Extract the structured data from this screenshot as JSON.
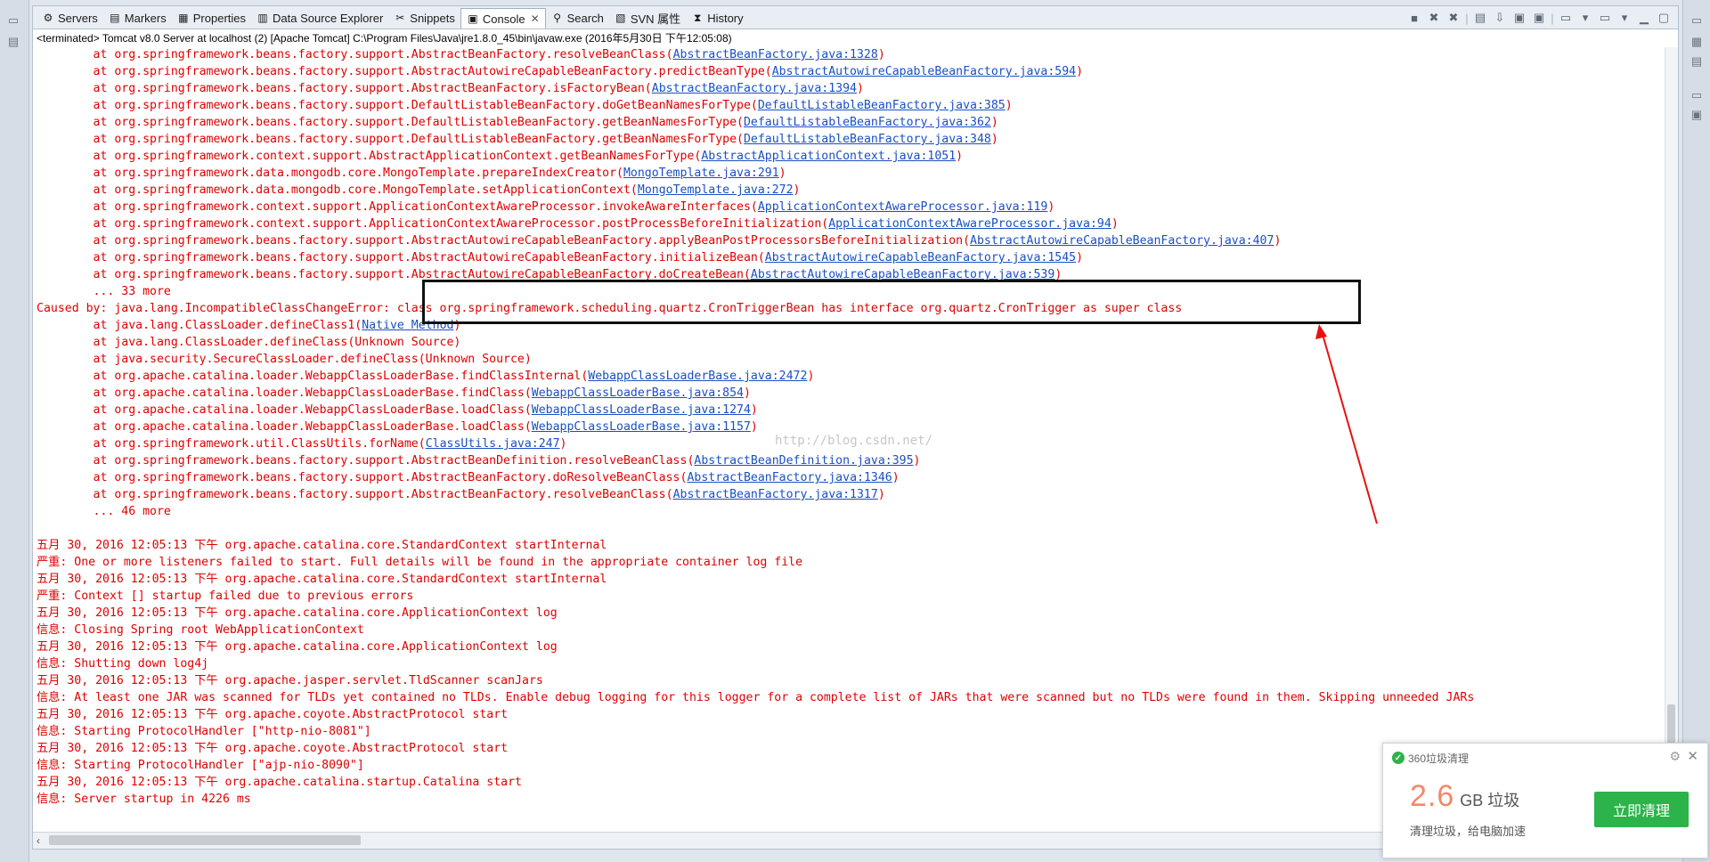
{
  "tabs": [
    {
      "label": "Servers",
      "icon": "servers-icon",
      "glyph": "⚙"
    },
    {
      "label": "Markers",
      "icon": "markers-icon",
      "glyph": "▤"
    },
    {
      "label": "Properties",
      "icon": "properties-icon",
      "glyph": "▦"
    },
    {
      "label": "Data Source Explorer",
      "icon": "data-source-icon",
      "glyph": "▥"
    },
    {
      "label": "Snippets",
      "icon": "snippets-icon",
      "glyph": "✂"
    },
    {
      "label": "Console",
      "icon": "console-icon",
      "glyph": "▣",
      "active": true,
      "close": "✕"
    },
    {
      "label": "Search",
      "icon": "search-icon",
      "glyph": "⚲"
    },
    {
      "label": "SVN 属性",
      "icon": "svn-icon",
      "glyph": "▧"
    },
    {
      "label": "History",
      "icon": "history-icon",
      "glyph": "⧗"
    }
  ],
  "console": {
    "status": "<terminated> Tomcat v8.0 Server at localhost (2) [Apache Tomcat] C:\\Program Files\\Java\\jre1.8.0_45\\bin\\javaw.exe (2016年5月30日 下午12:05:08)"
  },
  "log_lines": [
    {
      "text": "        at org.springframework.beans.factory.support.AbstractBeanFactory.resolveBeanClass(",
      "link": "AbstractBeanFactory.java:1328",
      "end": ")"
    },
    {
      "text": "        at org.springframework.beans.factory.support.AbstractAutowireCapableBeanFactory.predictBeanType(",
      "link": "AbstractAutowireCapableBeanFactory.java:594",
      "end": ")"
    },
    {
      "text": "        at org.springframework.beans.factory.support.AbstractBeanFactory.isFactoryBean(",
      "link": "AbstractBeanFactory.java:1394",
      "end": ")"
    },
    {
      "text": "        at org.springframework.beans.factory.support.DefaultListableBeanFactory.doGetBeanNamesForType(",
      "link": "DefaultListableBeanFactory.java:385",
      "end": ")"
    },
    {
      "text": "        at org.springframework.beans.factory.support.DefaultListableBeanFactory.getBeanNamesForType(",
      "link": "DefaultListableBeanFactory.java:362",
      "end": ")"
    },
    {
      "text": "        at org.springframework.beans.factory.support.DefaultListableBeanFactory.getBeanNamesForType(",
      "link": "DefaultListableBeanFactory.java:348",
      "end": ")"
    },
    {
      "text": "        at org.springframework.context.support.AbstractApplicationContext.getBeanNamesForType(",
      "link": "AbstractApplicationContext.java:1051",
      "end": ")"
    },
    {
      "text": "        at org.springframework.data.mongodb.core.MongoTemplate.prepareIndexCreator(",
      "link": "MongoTemplate.java:291",
      "end": ")"
    },
    {
      "text": "        at org.springframework.data.mongodb.core.MongoTemplate.setApplicationContext(",
      "link": "MongoTemplate.java:272",
      "end": ")"
    },
    {
      "text": "        at org.springframework.context.support.ApplicationContextAwareProcessor.invokeAwareInterfaces(",
      "link": "ApplicationContextAwareProcessor.java:119",
      "end": ")"
    },
    {
      "text": "        at org.springframework.context.support.ApplicationContextAwareProcessor.postProcessBeforeInitialization(",
      "link": "ApplicationContextAwareProcessor.java:94",
      "end": ")"
    },
    {
      "text": "        at org.springframework.beans.factory.support.AbstractAutowireCapableBeanFactory.applyBeanPostProcessorsBeforeInitialization(",
      "link": "AbstractAutowireCapableBeanFactory.java:407",
      "end": ")"
    },
    {
      "text": "        at org.springframework.beans.factory.support.AbstractAutowireCapableBeanFactory.initializeBean(",
      "link": "AbstractAutowireCapableBeanFactory.java:1545",
      "end": ")"
    },
    {
      "text": "        at org.springframework.beans.factory.support.AbstractAutowireCapableBeanFactory.doCreateBean(",
      "link": "AbstractAutowireCapableBeanFactory.java:539",
      "end": ")"
    },
    {
      "text": "        ... 33 more"
    },
    {
      "text": "Caused by: java.lang.IncompatibleClassChangeError: class org.springframework.scheduling.quartz.CronTriggerBean has interface org.quartz.CronTrigger as super class"
    },
    {
      "text": "        at java.lang.ClassLoader.defineClass1(",
      "link": "Native Method",
      "end": ")"
    },
    {
      "text": "        at java.lang.ClassLoader.defineClass(Unknown Source)"
    },
    {
      "text": "        at java.security.SecureClassLoader.defineClass(Unknown Source)"
    },
    {
      "text": "        at org.apache.catalina.loader.WebappClassLoaderBase.findClassInternal(",
      "link": "WebappClassLoaderBase.java:2472",
      "end": ")"
    },
    {
      "text": "        at org.apache.catalina.loader.WebappClassLoaderBase.findClass(",
      "link": "WebappClassLoaderBase.java:854",
      "end": ")"
    },
    {
      "text": "        at org.apache.catalina.loader.WebappClassLoaderBase.loadClass(",
      "link": "WebappClassLoaderBase.java:1274",
      "end": ")"
    },
    {
      "text": "        at org.apache.catalina.loader.WebappClassLoaderBase.loadClass(",
      "link": "WebappClassLoaderBase.java:1157",
      "end": ")"
    },
    {
      "text": "        at org.springframework.util.ClassUtils.forName(",
      "link": "ClassUtils.java:247",
      "end": ")"
    },
    {
      "text": "        at org.springframework.beans.factory.support.AbstractBeanDefinition.resolveBeanClass(",
      "link": "AbstractBeanDefinition.java:395",
      "end": ")"
    },
    {
      "text": "        at org.springframework.beans.factory.support.AbstractBeanFactory.doResolveBeanClass(",
      "link": "AbstractBeanFactory.java:1346",
      "end": ")"
    },
    {
      "text": "        at org.springframework.beans.factory.support.AbstractBeanFactory.resolveBeanClass(",
      "link": "AbstractBeanFactory.java:1317",
      "end": ")"
    },
    {
      "text": "        ... 46 more"
    },
    {
      "text": ""
    },
    {
      "text": "五月 30, 2016 12:05:13 下午 org.apache.catalina.core.StandardContext startInternal"
    },
    {
      "text": "严重: One or more listeners failed to start. Full details will be found in the appropriate container log file"
    },
    {
      "text": "五月 30, 2016 12:05:13 下午 org.apache.catalina.core.StandardContext startInternal"
    },
    {
      "text": "严重: Context [] startup failed due to previous errors"
    },
    {
      "text": "五月 30, 2016 12:05:13 下午 org.apache.catalina.core.ApplicationContext log"
    },
    {
      "text": "信息: Closing Spring root WebApplicationContext"
    },
    {
      "text": "五月 30, 2016 12:05:13 下午 org.apache.catalina.core.ApplicationContext log"
    },
    {
      "text": "信息: Shutting down log4j"
    },
    {
      "text": "五月 30, 2016 12:05:13 下午 org.apache.jasper.servlet.TldScanner scanJars"
    },
    {
      "text": "信息: At least one JAR was scanned for TLDs yet contained no TLDs. Enable debug logging for this logger for a complete list of JARs that were scanned but no TLDs were found in them. Skipping unneeded JARs"
    },
    {
      "text": "五月 30, 2016 12:05:13 下午 org.apache.coyote.AbstractProtocol start"
    },
    {
      "text": "信息: Starting ProtocolHandler [\"http-nio-8081\"]"
    },
    {
      "text": "五月 30, 2016 12:05:13 下午 org.apache.coyote.AbstractProtocol start"
    },
    {
      "text": "信息: Starting ProtocolHandler [\"ajp-nio-8090\"]"
    },
    {
      "text": "五月 30, 2016 12:05:13 下午 org.apache.catalina.startup.Catalina start"
    },
    {
      "text": "信息: Server startup in 4226 ms"
    }
  ],
  "watermark": "http://blog.csdn.net/",
  "popup": {
    "title": "360垃圾清理",
    "size_value": "2.6",
    "size_unit": "GB 垃圾",
    "description": "清理垃圾，给电脑加速",
    "button": "立即清理"
  },
  "colors": {
    "error_text": "#e00000",
    "link_text": "#1a4fc4",
    "accent_green": "#2cb34a",
    "popup_number": "#f08a6c"
  }
}
